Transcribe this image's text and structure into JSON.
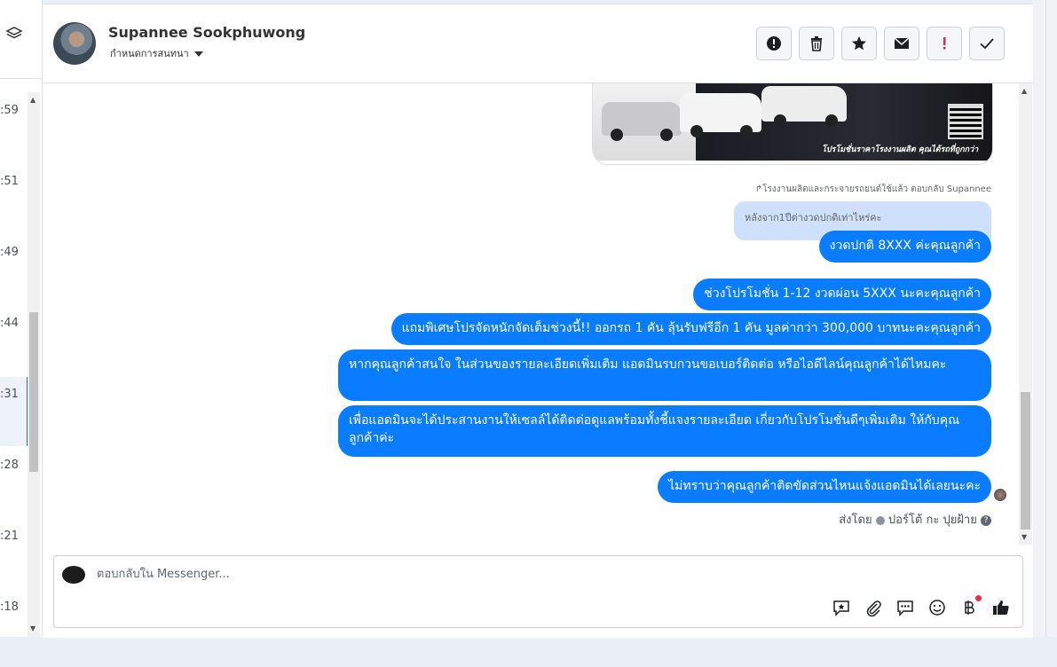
{
  "conversation_list": {
    "times": [
      ":59",
      ":51",
      ":49",
      ":44",
      ":31",
      ":28",
      ":21",
      ":18"
    ]
  },
  "header": {
    "contact_name": "Supannee Sookphuwong",
    "assign_label": "กำหนดการสนทนา",
    "toolbar_icons": [
      "alert-circle-icon",
      "trash-icon",
      "star-icon",
      "envelope-icon",
      "exclamation-icon",
      "check-icon"
    ]
  },
  "ad": {
    "caption": "โปรโมชั่นราคาโรงงานผลิต คุณได้รถที่ถูกกว่า"
  },
  "reply_note": "โรงงานผลิตและกระจายรถยนต์ใช้แล้ว ตอบกลับ Supannee",
  "quoted_message": "หลังจาก1ปีต่างวดปกติเท่าไหร่คะ",
  "messages": [
    "งวดปกติ 8XXX ค่ะคุณลูกค้า",
    "ช่วงโปรโมชั่น 1-12 งวดผ่อน 5XXX นะคะคุณลูกค้า",
    "แถมพิเศษโปรจัดหนักจัดเต็มช่วงนี้!! ออกรถ 1 คัน ลุ้นรับฟรีอีก 1 คัน มูลค่ากว่า 300,000 บาทนะคะคุณลูกค้า",
    "หากคุณลูกค้าสนใจ ในส่วนของรายละเอียดเพิ่มเติม แอดมินรบกวนขอเบอร์ติดต่อ หรือไอดีไลน์คุณลูกค้าได้ไหมคะ",
    "เพื่อแอดมินจะได้ประสานงานให้เซลล์ได้ติดต่อดูแลพร้อมทั้งชี้แจงรายละเอียด เกี่ยวกับโปรโมชั่นดีๆเพิ่มเติม ให้กับคุณลูกค้าค่ะ",
    "ไม่ทราบว่าคุณลูกค้าติดขัดส่วนไหนแจ้งแอดมินได้เลยนะคะ"
  ],
  "sent_by": {
    "prefix": "ส่งโดย",
    "name": "ปอร์โต้ กะ ปุยฝ้าย"
  },
  "composer": {
    "placeholder": "ตอบกลับใน Messenger...",
    "icons": [
      "saved-reply-icon",
      "attachment-icon",
      "message-icon",
      "emoji-icon",
      "baht-payment-icon",
      "thumbs-up-icon"
    ]
  },
  "colors": {
    "bubble": "#0a7cff",
    "quoted_bg": "#cfe0fb"
  }
}
